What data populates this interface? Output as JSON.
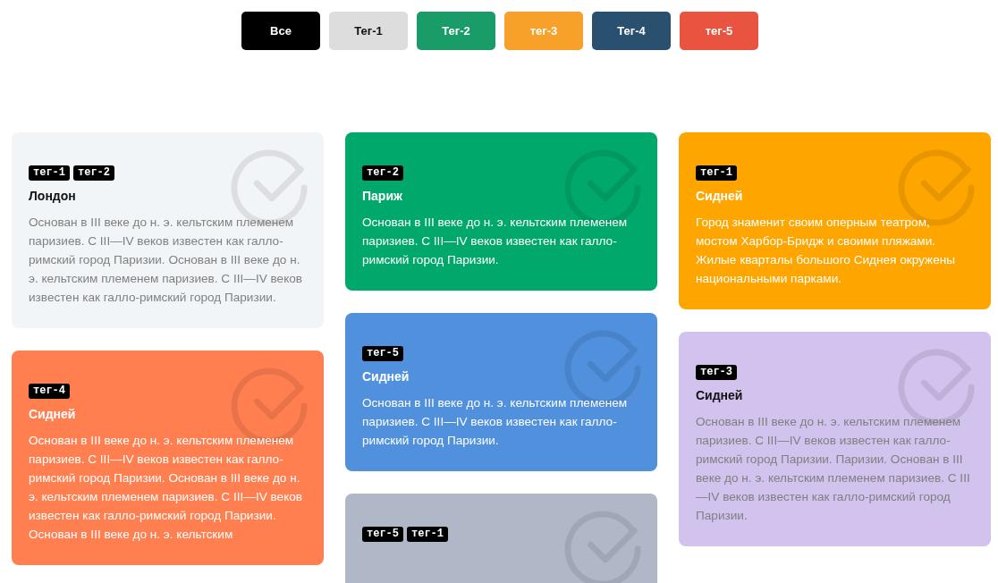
{
  "filters": [
    {
      "label": "Все",
      "color": "#000000"
    },
    {
      "label": "Тег-1",
      "color": "#dddddd"
    },
    {
      "label": "Тег-2",
      "color": "#1a9c68"
    },
    {
      "label": "тег-3",
      "color": "#f7a12b"
    },
    {
      "label": "Тег-4",
      "color": "#2a5070"
    },
    {
      "label": "тег-5",
      "color": "#e8543f"
    }
  ],
  "columns": [
    [
      {
        "color": "#f2f5f8",
        "tags": [
          "тег-1",
          "тег-2"
        ],
        "title": "Лондон",
        "text": "Основан в III веке до н. э. кельтским племенем паризиев. С III—IV веков известен как галло-римский город Паризии.  Основан в III веке до н. э. кельтским племенем паризиев. С III—IV веков известен как галло-римский город Паризии."
      },
      {
        "color": "#ff7f50",
        "tags": [
          "тег-4"
        ],
        "title": "Сидней",
        "text": "Основан в III веке до н. э. кельтским племенем паризиев. С III—IV веков известен как галло-римский город Паризии. Основан в III веке до н. э. кельтским племенем паризиев. С III—IV веков известен как галло-римский город Паризии. Основан в III веке до н. э. кельтским"
      }
    ],
    [
      {
        "color": "#00a86b",
        "tags": [
          "тег-2"
        ],
        "title": "Париж",
        "text": "Основан в III веке до н. э. кельтским племенем паризиев. С III—IV веков известен как галло-римский город Паризии."
      },
      {
        "color": "#5090dd",
        "tags": [
          "тег-5"
        ],
        "title": "Сидней",
        "text": "Основан в III веке до н. э. кельтским племенем паризиев. С III—IV веков известен как галло-римский город Паризии."
      },
      {
        "color": "#b0b7c6",
        "tags": [
          "тег-5",
          "тег-1"
        ]
      }
    ],
    [
      {
        "color": "#ffa500",
        "tags": [
          "тег-1"
        ],
        "title": "Сидней",
        "text": "Город знаменит своим оперным театром, мостом Харбор-Бридж и своими пляжами. Жилые кварталы большого Сиднея окружены национальными парками."
      },
      {
        "color": "#d2c2ee",
        "tags": [
          "тег-3"
        ],
        "title": "Сидней",
        "text": "Основан в III веке до н. э. кельтским племенем паризиев. С III—IV веков известен как галло-римский город Паризии. Паризии. Основан в III веке до н. э. кельтским племенем паризиев. С III—IV веков известен как галло-римский город Паризии."
      }
    ]
  ]
}
